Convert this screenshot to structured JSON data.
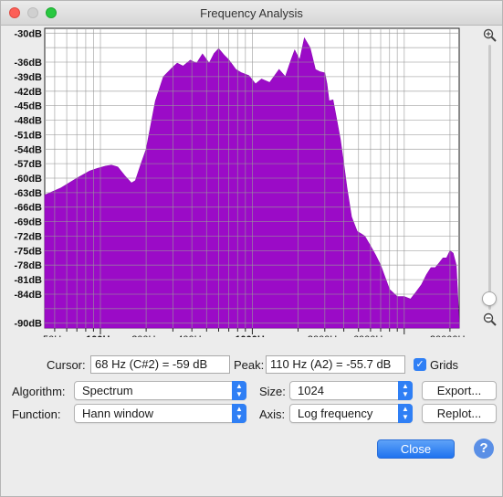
{
  "window": {
    "title": "Frequency Analysis"
  },
  "colors": {
    "spectrum_fill": "#9b0bc7",
    "accent": "#2f7ff5"
  },
  "chart_data": {
    "type": "area",
    "x_scale": "log",
    "grid": true,
    "y_ticks": [
      "-30dB",
      "-36dB",
      "-39dB",
      "-42dB",
      "-45dB",
      "-48dB",
      "-51dB",
      "-54dB",
      "-57dB",
      "-60dB",
      "-63dB",
      "-66dB",
      "-69dB",
      "-72dB",
      "-75dB",
      "-78dB",
      "-81dB",
      "-84dB",
      "-90dB"
    ],
    "x_ticks": [
      "50Hz",
      "100Hz",
      "200Hz",
      "400Hz",
      "1000Hz",
      "3000Hz",
      "6000Hz",
      "20000Hz"
    ],
    "ylim": [
      -91,
      -29
    ],
    "xlim": [
      43,
      23000
    ],
    "series": [
      {
        "x": [
          43,
          55,
          70,
          85,
          95,
          108,
          118,
          130,
          145,
          160,
          170,
          185,
          200,
          230,
          260,
          300,
          320,
          350,
          390,
          430,
          470,
          520,
          560,
          600,
          650,
          700,
          780,
          850,
          950,
          1050,
          1150,
          1300,
          1500,
          1650,
          1800,
          1900,
          2050,
          2200,
          2400,
          2600,
          2800,
          3000,
          3100,
          3200,
          3400,
          3600,
          3800,
          4000,
          4200,
          4500,
          4900,
          5200,
          5500,
          6000,
          6500,
          7000,
          8000,
          9000,
          10000,
          11000,
          12000,
          13000,
          14000,
          15000,
          16000,
          17000,
          18000,
          19000,
          20000,
          21000,
          22000,
          22500,
          23000
        ],
        "y": [
          -63.5,
          -62,
          -60,
          -58.5,
          -58,
          -57.5,
          -57.3,
          -57.7,
          -59.5,
          -61,
          -60.5,
          -57,
          -54,
          -44,
          -39,
          -37,
          -36.2,
          -36.8,
          -35.6,
          -36.2,
          -34.3,
          -36.2,
          -34.2,
          -33.2,
          -34.5,
          -35.5,
          -37.5,
          -38.2,
          -38.8,
          -40.5,
          -39.5,
          -40.2,
          -37.5,
          -39,
          -35.5,
          -33.5,
          -35.5,
          -31,
          -33,
          -37.5,
          -38,
          -38.2,
          -40.5,
          -44,
          -43.8,
          -48,
          -52,
          -57,
          -62,
          -68,
          -71,
          -71.5,
          -72,
          -74,
          -76,
          -78,
          -83,
          -84.5,
          -84.5,
          -85,
          -83.5,
          -82,
          -80,
          -78.5,
          -78.5,
          -77.5,
          -76.5,
          -76.5,
          -75,
          -75.5,
          -78,
          -84,
          -90
        ]
      }
    ]
  },
  "cursor": {
    "label": "Cursor:",
    "value": "68 Hz (C#2) = -59 dB"
  },
  "peak": {
    "label": "Peak:",
    "value": "110 Hz (A2) = -55.7 dB"
  },
  "grids": {
    "label": "Grids",
    "checked": true
  },
  "algorithm": {
    "label": "Algorithm:",
    "value": "Spectrum"
  },
  "size": {
    "label": "Size:",
    "value": "1024"
  },
  "function": {
    "label": "Function:",
    "value": "Hann window"
  },
  "axis": {
    "label": "Axis:",
    "value": "Log frequency"
  },
  "buttons": {
    "export": "Export...",
    "replot": "Replot...",
    "close": "Close",
    "help": "?"
  },
  "icons": {
    "zoom_in": "zoom-in-icon",
    "zoom_out": "zoom-out-icon"
  }
}
